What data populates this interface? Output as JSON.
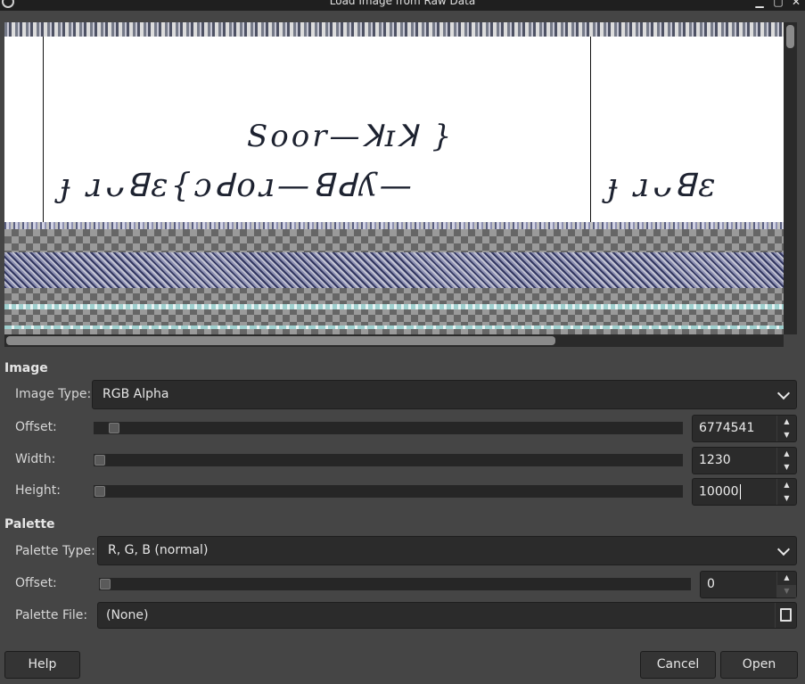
{
  "window": {
    "title": "Load Image from Raw Data"
  },
  "preview": {
    "text_lines": [
      "Soor—ꓘɪꓘ }",
      "ɟ ɹᴗꓭɛ{ɔꓒoɹ—ꓭꓒʎ—",
      "ɟ ɹᴗꓭɛ"
    ]
  },
  "image_section": {
    "title": "Image",
    "image_type_label": "Image Type:",
    "image_type_value": "RGB Alpha",
    "offset_label": "Offset:",
    "offset_value": "6774541",
    "width_label": "Width:",
    "width_value": "1230",
    "height_label": "Height:",
    "height_value": "10000"
  },
  "palette_section": {
    "title": "Palette",
    "palette_type_label": "Palette Type:",
    "palette_type_value": "R, G, B (normal)",
    "offset_label": "Offset:",
    "offset_value": "0",
    "palette_file_label": "Palette File:",
    "palette_file_value": "(None)"
  },
  "buttons": {
    "help": "Help",
    "cancel": "Cancel",
    "open": "Open"
  },
  "icons": {
    "spin_up": "▲",
    "spin_down": "▼",
    "minimize": "▁",
    "maximize": "▢",
    "close": "✕"
  },
  "colors": {
    "background": "#454545",
    "field": "#2b2b2b",
    "titlebar": "#1f1f1f"
  }
}
